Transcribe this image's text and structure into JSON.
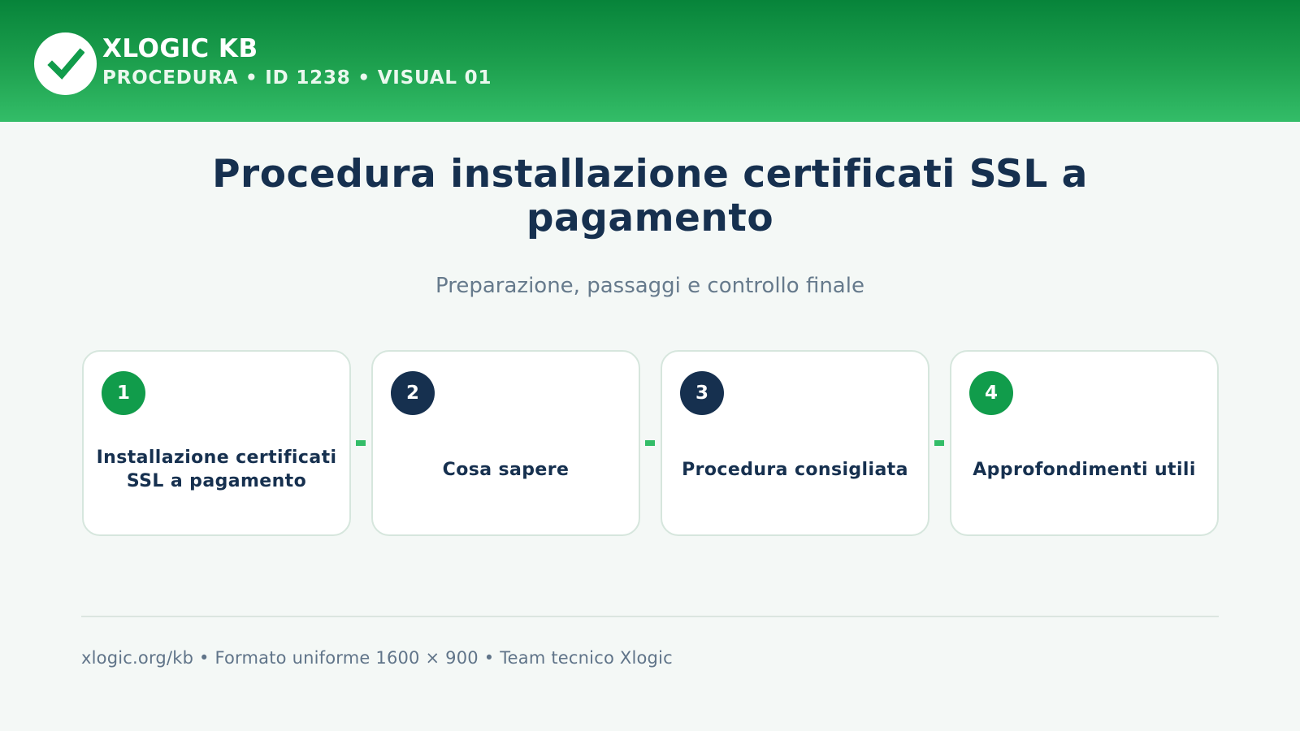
{
  "header": {
    "brand_title": "XLOGIC KB",
    "brand_subtitle": "PROCEDURA • ID 1238 • VISUAL 01",
    "logo_icon": "check-icon"
  },
  "main": {
    "title": "Procedura installazione certificati SSL a pagamento",
    "subtitle": "Preparazione, passaggi e controllo finale"
  },
  "steps": [
    {
      "number": "1",
      "label": "Installazione certificati SSL a pagamento",
      "badge_color": "#119c4b"
    },
    {
      "number": "2",
      "label": "Cosa sapere",
      "badge_color": "#16304f"
    },
    {
      "number": "3",
      "label": "Procedura consigliata",
      "badge_color": "#16304f"
    },
    {
      "number": "4",
      "label": "Approfondimenti utili",
      "badge_color": "#119c4b"
    }
  ],
  "footer": {
    "text": "xlogic.org/kb • Formato uniforme 1600 × 900 • Team tecnico Xlogic"
  },
  "colors": {
    "header_green": "#1ea14f",
    "accent_green": "#33bd68",
    "navy": "#16304f",
    "background": "#f4f8f6"
  }
}
